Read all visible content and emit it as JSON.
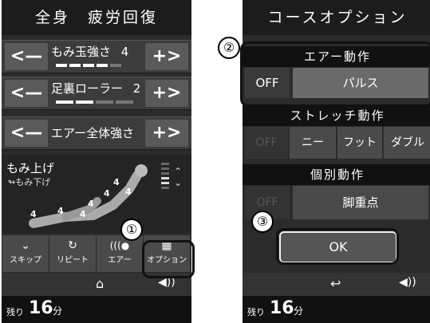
{
  "left_screen": {
    "title": "全身　疲労回復",
    "rows": [
      {
        "label": "もみ玉強さ",
        "value": "4",
        "bars_on": 4,
        "bars_total": 5
      },
      {
        "label": "足裏ローラー",
        "value": "2",
        "bars_on": 2,
        "bars_total": 5
      },
      {
        "label": "エアー全体強さ",
        "value": ""
      }
    ],
    "arrow_left": "<—",
    "arrow_right": "+>",
    "mode_main": "もみ上げ",
    "mode_sub": "↬もみ下げ",
    "level_marks": [
      "4",
      "4",
      "4",
      "4",
      "4",
      "4",
      "4"
    ],
    "buttons": [
      {
        "label": "スキップ",
        "icon": "chevron-down-icon"
      },
      {
        "label": "リピート",
        "icon": "repeat-icon"
      },
      {
        "label": "エアー",
        "icon": "air-icon"
      },
      {
        "label": "オプション",
        "icon": "grid-icon"
      }
    ],
    "footer": {
      "remain_label": "残り",
      "remain_value": "16",
      "remain_unit": "分"
    }
  },
  "right_screen": {
    "title": "コースオプション",
    "air_header": "エアー動作",
    "air_off": "OFF",
    "air_mode": "パルス",
    "stretch_header": "ストレッチ動作",
    "stretch_off": "OFF",
    "stretch_options": [
      "ニー",
      "フット",
      "ダブル"
    ],
    "individual_header": "個別動作",
    "individual_off": "OFF",
    "individual_option": "脚重点",
    "ok": "OK",
    "footer": {
      "remain_label": "残り",
      "remain_value": "16",
      "remain_unit": "分"
    }
  },
  "callouts": [
    "①",
    "②",
    "③"
  ]
}
